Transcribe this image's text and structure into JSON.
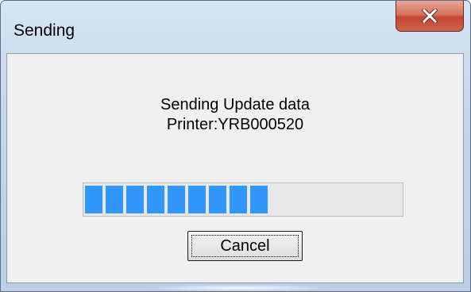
{
  "window": {
    "title": "Sending"
  },
  "titlebar": {
    "close_icon": "close-icon"
  },
  "message": {
    "line1": "Sending Update data",
    "line2": "Printer:YRB000520"
  },
  "progress": {
    "fraction": 0.56,
    "color": "#3297fd"
  },
  "buttons": {
    "cancel_label": "Cancel"
  }
}
